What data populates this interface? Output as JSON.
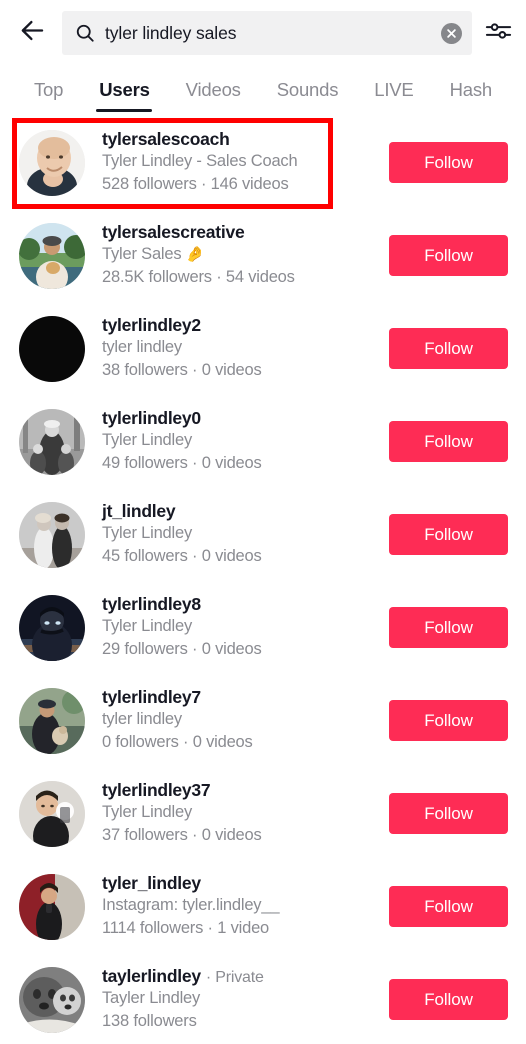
{
  "header": {
    "back_icon": "arrow-left-icon",
    "search": {
      "icon": "search-icon",
      "value": "tyler lindley sales",
      "placeholder": "Search",
      "clear_icon": "close-circle-icon"
    },
    "filter_icon": "filter-sliders-icon"
  },
  "tabs": [
    {
      "label": "Top",
      "active": false
    },
    {
      "label": "Users",
      "active": true
    },
    {
      "label": "Videos",
      "active": false
    },
    {
      "label": "Sounds",
      "active": false
    },
    {
      "label": "LIVE",
      "active": false
    },
    {
      "label": "Hash",
      "active": false
    }
  ],
  "follow_label": "Follow",
  "accent_color": "#FE2C55",
  "highlight_color": "#FF0000",
  "results": [
    {
      "username": "tylersalescoach",
      "private": "",
      "nickname": "Tyler Lindley - Sales Coach",
      "emoji": "",
      "stats": "528 followers · 146 videos",
      "follow": "Follow",
      "highlighted": true
    },
    {
      "username": "tylersalescreative",
      "private": "",
      "nickname": "Tyler Sales",
      "emoji": "🤌",
      "stats": "28.5K followers · 54 videos",
      "follow": "Follow",
      "highlighted": false
    },
    {
      "username": "tylerlindley2",
      "private": "",
      "nickname": "tyler lindley",
      "emoji": "",
      "stats": "38 followers · 0 videos",
      "follow": "Follow",
      "highlighted": false
    },
    {
      "username": "tylerlindley0",
      "private": "",
      "nickname": "Tyler Lindley",
      "emoji": "",
      "stats": "49 followers · 0 videos",
      "follow": "Follow",
      "highlighted": false
    },
    {
      "username": "jt_lindley",
      "private": "",
      "nickname": "Tyler Lindley",
      "emoji": "",
      "stats": "45 followers · 0 videos",
      "follow": "Follow",
      "highlighted": false
    },
    {
      "username": "tylerlindley8",
      "private": "",
      "nickname": "Tyler Lindley",
      "emoji": "",
      "stats": "29 followers · 0 videos",
      "follow": "Follow",
      "highlighted": false
    },
    {
      "username": "tylerlindley7",
      "private": "",
      "nickname": "tyler lindley",
      "emoji": "",
      "stats": "0 followers · 0 videos",
      "follow": "Follow",
      "highlighted": false
    },
    {
      "username": "tylerlindley37",
      "private": "",
      "nickname": "Tyler Lindley",
      "emoji": "",
      "stats": "37 followers · 0 videos",
      "follow": "Follow",
      "highlighted": false
    },
    {
      "username": "tyler_lindley",
      "private": "",
      "nickname": "Instagram: tyler.lindley__",
      "emoji": "",
      "stats": "1114 followers · 1 video",
      "follow": "Follow",
      "highlighted": false
    },
    {
      "username": "taylerlindley",
      "private": "· Private",
      "nickname": "Tayler Lindley",
      "emoji": "",
      "stats": "138 followers",
      "follow": "Follow",
      "highlighted": false
    }
  ]
}
